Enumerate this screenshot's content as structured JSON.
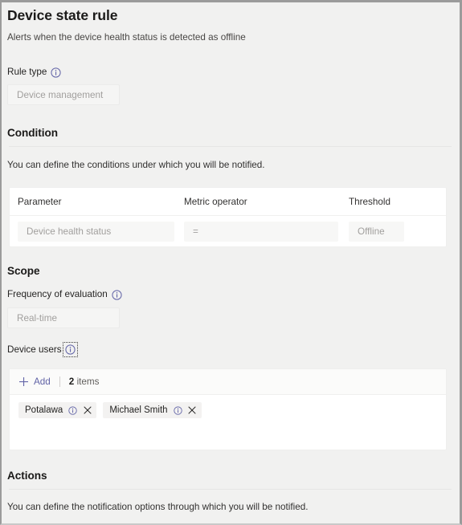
{
  "header": {
    "title": "Device state rule",
    "subtitle": "Alerts when the device health status is detected as offline"
  },
  "rule_type": {
    "label": "Rule type",
    "info_icon": "info-circle-icon",
    "value": "Device management"
  },
  "condition": {
    "heading": "Condition",
    "description": "You can define the conditions under which you will be notified.",
    "columns": [
      "Parameter",
      "Metric operator",
      "Threshold"
    ],
    "row": {
      "parameter": "Device health status",
      "metric_operator": "=",
      "threshold": "Offline"
    }
  },
  "scope": {
    "heading": "Scope",
    "frequency": {
      "label": "Frequency of evaluation",
      "info_icon": "info-circle-icon",
      "value": "Real-time"
    },
    "device_users": {
      "label": "Device users",
      "info_icon": "info-circle-icon",
      "toolbar": {
        "add_label": "Add",
        "add_icon": "plus-icon",
        "count": "2",
        "count_suffix": "items"
      },
      "chips": [
        {
          "name": "Potalawa",
          "info_icon": "info-circle-icon",
          "close_icon": "close-icon"
        },
        {
          "name": "Michael Smith",
          "info_icon": "info-circle-icon",
          "close_icon": "close-icon"
        }
      ]
    }
  },
  "actions": {
    "heading": "Actions",
    "description": "You can define the notification options through which you will be notified."
  },
  "colors": {
    "accent": "#6264a7",
    "page_background": "#f1f1f0",
    "card_background": "#ffffff",
    "text_primary": "#252423",
    "text_secondary": "#605e5c",
    "placeholder": "#a19f9d"
  }
}
